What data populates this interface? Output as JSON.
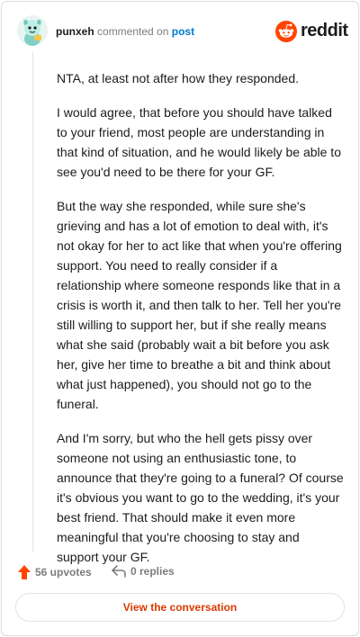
{
  "header": {
    "username": "punxeh",
    "action": "commented on",
    "target": "post",
    "brand": "reddit"
  },
  "comment": {
    "paragraphs": [
      "NTA, at least not after how they responded.",
      "I would agree, that before you should have talked to your friend, most people are understanding in that kind of situation, and he would likely be able to see you'd need to be there for your GF.",
      "But the way she responded, while sure she's grieving and has a lot of emotion to deal with, it's not okay for her to act like that when you're offering support. You need to really consider if a relationship where someone responds like that in a crisis is worth it, and then talk to her. Tell her you're still willing to support her, but if she really means what she said (probably wait a bit before you ask her, give her time to breathe a bit and think about what just happened), you should not go to the funeral.",
      "And I'm sorry, but who the hell gets pissy over someone not using an enthusiastic tone, to announce that they're going to a funeral? Of course it's obvious you want to go to the wedding, it's your best friend. That should make it even more meaningful that you're choosing to stay and support your GF."
    ]
  },
  "footer": {
    "upvotes": "56 upvotes",
    "replies": "0 replies"
  },
  "cta": {
    "label": "View the conversation"
  },
  "colors": {
    "accent": "#ff4500",
    "link": "#0079d3",
    "cta": "#d93a00"
  },
  "icons": [
    "avatar-snoo",
    "reddit-logo-icon",
    "upvote-arrow-icon",
    "reply-arrow-icon"
  ]
}
